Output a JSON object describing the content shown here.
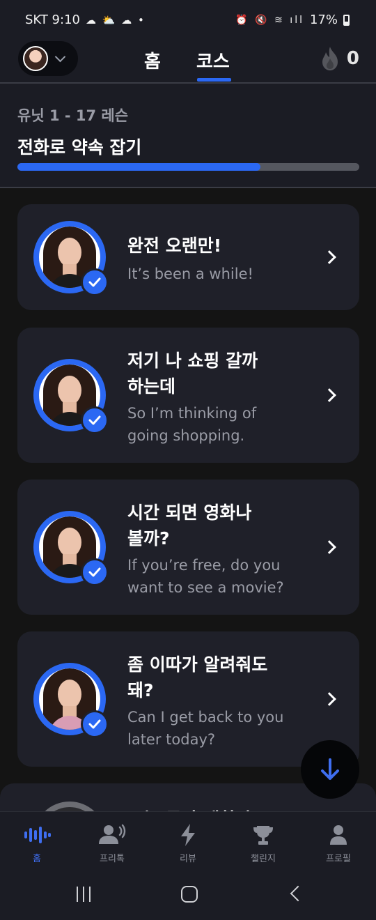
{
  "status_bar": {
    "carrier_time": "SKT 9:10",
    "left_icons": [
      "cloud-icon",
      "partly-cloudy-icon",
      "weather-icon",
      "dot-icon"
    ],
    "right_icons": [
      "alarm-icon",
      "mute-icon",
      "wifi-icon",
      "signal-icon"
    ],
    "battery": "17%"
  },
  "header": {
    "tabs": [
      {
        "label": "홈",
        "active": false
      },
      {
        "label": "코스",
        "active": true
      }
    ],
    "streak_count": "0",
    "accent_color": "#2b68f3"
  },
  "unit": {
    "subtitle": "유닛 1 - 17 레슨",
    "title": "전화로 약속 잡기",
    "progress_fraction": 0.71
  },
  "lessons": [
    {
      "title": "완전 오랜만!",
      "subtitle": "It’s been a while!",
      "completed": true
    },
    {
      "title": "저기 나 쇼핑 갈까\n하는데",
      "subtitle": "So I’m thinking of\ngoing shopping.",
      "completed": true
    },
    {
      "title": "시간 되면 영화나\n볼까?",
      "subtitle": "If you’re free, do you\nwant to see a movie?",
      "completed": true
    },
    {
      "title": "좀 이따가 알려줘도\n돼?",
      "subtitle": "Can I get back to you\nlater today?",
      "completed": true
    },
    {
      "title": "오늘 무사 괜찮아?",
      "completed": false
    }
  ],
  "bottom_nav": [
    {
      "label": "홈",
      "icon": "voice-wave-icon",
      "active": true
    },
    {
      "label": "프리톡",
      "icon": "speaking-person-icon",
      "active": false
    },
    {
      "label": "리뷰",
      "icon": "lightning-icon",
      "active": false
    },
    {
      "label": "챌린지",
      "icon": "trophy-icon",
      "active": false
    },
    {
      "label": "프로필",
      "icon": "person-icon",
      "active": false
    }
  ]
}
